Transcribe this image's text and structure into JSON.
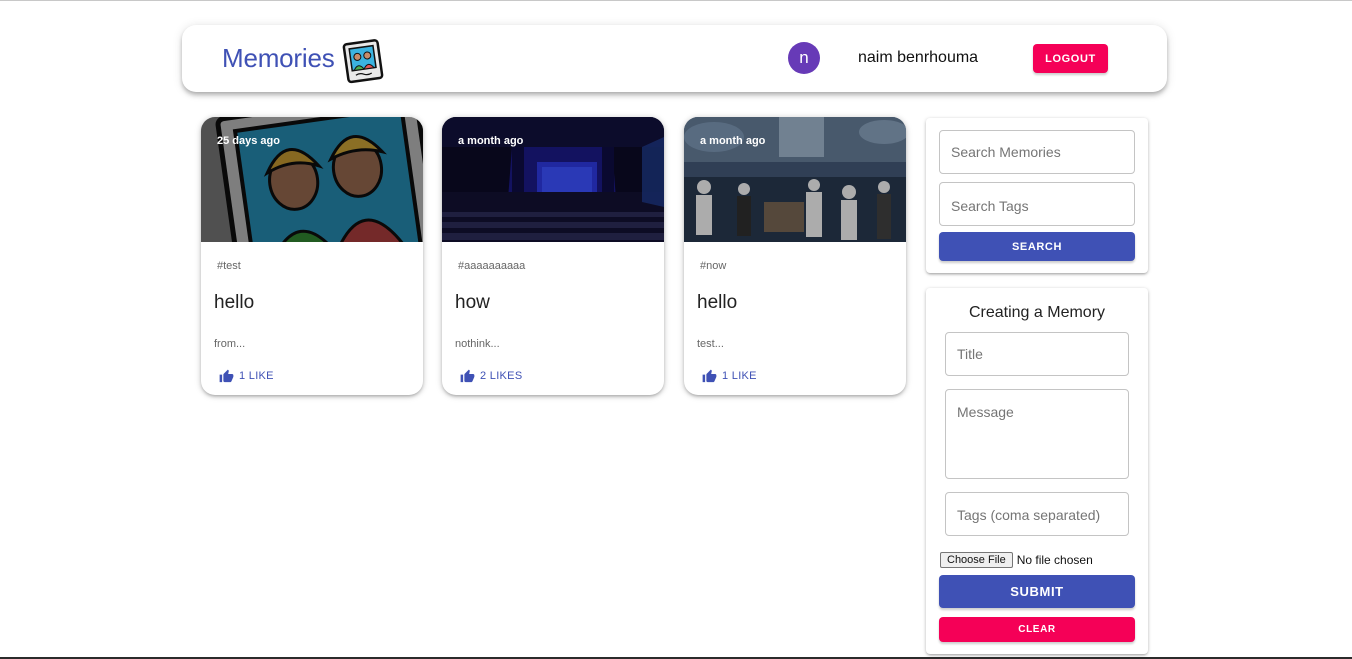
{
  "header": {
    "brand": "Memories",
    "avatar_initial": "n",
    "username": "naim benrhouma",
    "logout_label": "LOGOUT"
  },
  "posts": [
    {
      "time": "25 days ago",
      "tags": "#test",
      "title": "hello",
      "message": "from...",
      "likes": "1 LIKE",
      "image": "photo-frame-illustration"
    },
    {
      "time": "a month ago",
      "tags": "#aaaaaaaaaa",
      "title": "how",
      "message": "nothink...",
      "likes": "2 LIKES",
      "image": "theater-stage-photo"
    },
    {
      "time": "a month ago",
      "tags": "#now",
      "title": "hello",
      "message": "test...",
      "likes": "1 LIKE",
      "image": "party-event-photo"
    }
  ],
  "search": {
    "memories_placeholder": "Search Memories",
    "tags_placeholder": "Search Tags",
    "button_label": "SEARCH"
  },
  "form": {
    "title": "Creating a Memory",
    "title_placeholder": "Title",
    "message_placeholder": "Message",
    "tags_placeholder": "Tags (coma separated)",
    "file_button": "Choose File",
    "file_status": "No file chosen",
    "submit_label": "SUBMIT",
    "clear_label": "CLEAR"
  },
  "colors": {
    "primary": "#3f51b5",
    "secondary": "#f50057",
    "avatar": "#673ab7"
  }
}
